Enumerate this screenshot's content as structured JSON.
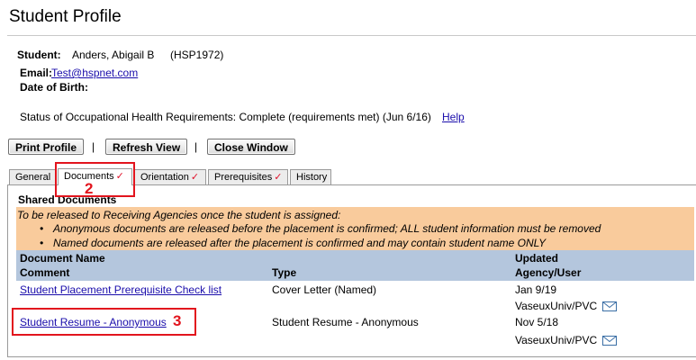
{
  "page": {
    "title": "Student Profile"
  },
  "student": {
    "label": "Student:",
    "name": "Anders, Abigail B",
    "id": "(HSP1972)",
    "email_label": "Email:",
    "email": "Test@hspnet.com",
    "dob_label": "Date of Birth:",
    "status": "Status of Occupational Health Requirements: Complete (requirements met) (Jun 6/16)",
    "help_link": "Help"
  },
  "toolbar": {
    "print_label": "Print Profile",
    "refresh_label": "Refresh View",
    "close_label": "Close Window",
    "separator": "|"
  },
  "tabs": [
    {
      "label": "General",
      "checked": false
    },
    {
      "label": "Documents",
      "checked": true,
      "active": true
    },
    {
      "label": "Orientation",
      "checked": true
    },
    {
      "label": "Prerequisites",
      "checked": true
    },
    {
      "label": "History",
      "checked": false
    }
  ],
  "check_mark": "✓",
  "shared": {
    "heading": "Shared Documents",
    "notice": "To be released to Receiving Agencies once the student is assigned:",
    "bullets": [
      "Anonymous documents are released before the placement is confirmed; ALL student information must be removed",
      "Named documents are released after the placement is confirmed and may contain student name ONLY"
    ]
  },
  "table": {
    "col_doc_name": "Document Name",
    "col_comment": "Comment",
    "col_type": "Type",
    "col_updated": "Updated",
    "col_agency": "Agency/User",
    "rows": [
      {
        "name": "Student Placement Prerequisite Check list",
        "type": "Cover Letter (Named)",
        "date": "Jan 9/19",
        "agency": "VaseuxUniv/PVC"
      },
      {
        "name": "Student Resume - Anonymous",
        "type": "Student Resume - Anonymous",
        "date": "Nov 5/18",
        "agency": "VaseuxUniv/PVC"
      }
    ]
  },
  "annotations": {
    "step_2": "2",
    "step_3": "3",
    "color": "#e2141d"
  },
  "colors": {
    "notice_bg": "#f9cb9c",
    "header_bg": "#b4c6dd",
    "link": "#1a0dab",
    "check": "#e0102a"
  }
}
